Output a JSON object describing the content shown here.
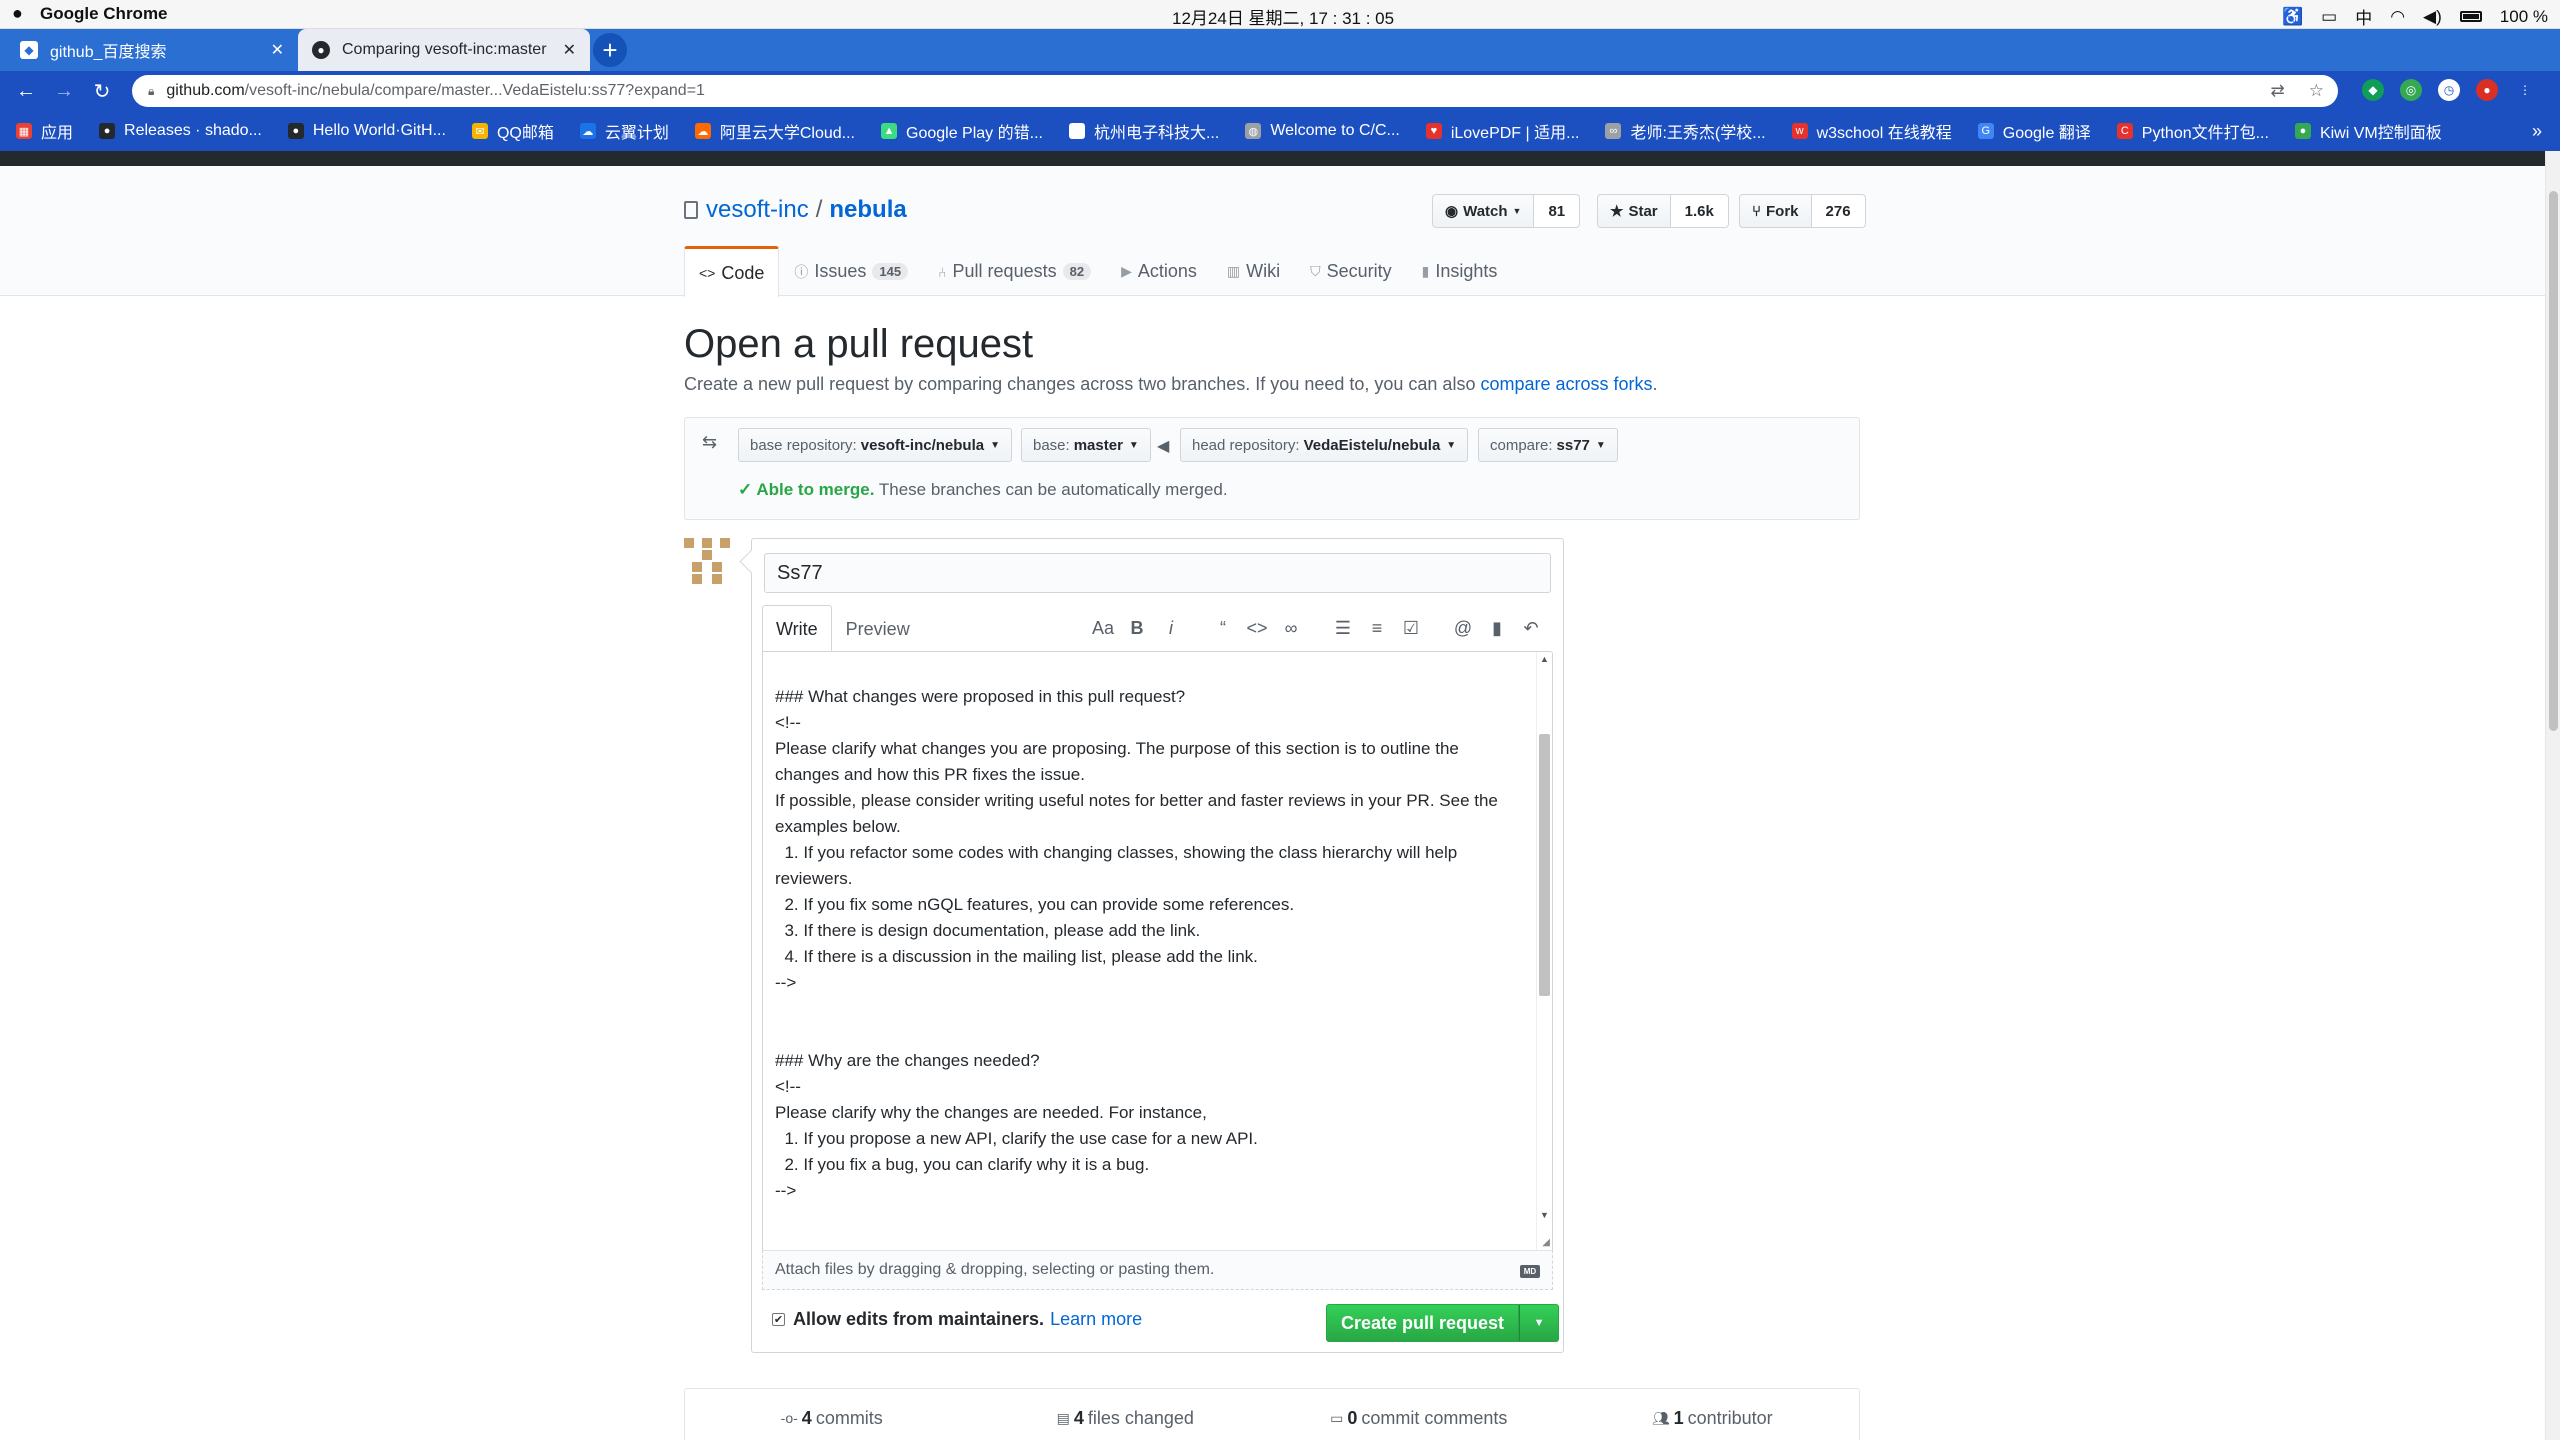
{
  "menubar": {
    "app_name": "Google Chrome",
    "clock": "12月24日 星期二, 17 : 31 : 05",
    "input_method": "中",
    "battery": "100 %"
  },
  "tabs": [
    {
      "title": "github_百度搜索",
      "close": "✕"
    },
    {
      "title": "Comparing vesoft-inc:master",
      "close": "✕"
    }
  ],
  "omnibox": {
    "host": "github.com",
    "path": "/vesoft-inc/nebula/compare/master...VedaEistelu:ss77?expand=1"
  },
  "bookmarks": [
    {
      "label": "应用",
      "icon": "apps-grid-icon",
      "color": "#e94235"
    },
    {
      "label": "Releases · shado...",
      "icon": "github-icon",
      "color": "#24292e"
    },
    {
      "label": "Hello World·GitH...",
      "icon": "github-icon",
      "color": "#24292e"
    },
    {
      "label": "QQ邮箱",
      "icon": "mail-icon",
      "color": "#f4b400"
    },
    {
      "label": "云翼计划",
      "icon": "cloud-icon",
      "color": "#1a73e8"
    },
    {
      "label": "阿里云大学Cloud...",
      "icon": "cloud-icon",
      "color": "#ff6a00"
    },
    {
      "label": "Google Play 的错...",
      "icon": "android-icon",
      "color": "#3ddc84"
    },
    {
      "label": "杭州电子科技大...",
      "icon": "page-icon",
      "color": "#ffffff"
    },
    {
      "label": "Welcome to C/C...",
      "icon": "globe-icon",
      "color": "#9aa0a6"
    },
    {
      "label": "iLovePDF | 适用...",
      "icon": "heart-icon",
      "color": "#e5322d"
    },
    {
      "label": "老师:王秀杰(学校...",
      "icon": "link-icon",
      "color": "#9aa0a6"
    },
    {
      "label": "w3school 在线教程",
      "icon": "w3-icon",
      "color": "#e5322d"
    },
    {
      "label": "Google 翻译",
      "icon": "translate-icon",
      "color": "#4285f4"
    },
    {
      "label": "Python文件打包...",
      "icon": "c-icon",
      "color": "#e5322d"
    },
    {
      "label": "Kiwi VM控制面板",
      "icon": "kiwi-icon",
      "color": "#34a853"
    }
  ],
  "repo": {
    "owner": "vesoft-inc",
    "separator": "/",
    "name": "nebula",
    "watch_label": "Watch",
    "watch_count": "81",
    "star_label": "Star",
    "star_count": "1.6k",
    "fork_label": "Fork",
    "fork_count": "276"
  },
  "reponav": [
    {
      "label": "Code",
      "icon": "code-icon",
      "count": ""
    },
    {
      "label": "Issues",
      "icon": "issue-icon",
      "count": "145"
    },
    {
      "label": "Pull requests",
      "icon": "pr-icon",
      "count": "82"
    },
    {
      "label": "Actions",
      "icon": "play-icon",
      "count": ""
    },
    {
      "label": "Wiki",
      "icon": "book-icon",
      "count": ""
    },
    {
      "label": "Security",
      "icon": "shield-icon",
      "count": ""
    },
    {
      "label": "Insights",
      "icon": "graph-icon",
      "count": ""
    }
  ],
  "subhead": {
    "title": "Open a pull request",
    "description": "Create a new pull request by comparing changes across two branches. If you need to, you can also ",
    "link": "compare across forks",
    "period": "."
  },
  "range": {
    "base_repo_label": "base repository:",
    "base_repo_value": "vesoft-inc/nebula",
    "base_label": "base:",
    "base_value": "master",
    "head_repo_label": "head repository:",
    "head_repo_value": "VedaEistelu/nebula",
    "compare_label": "compare:",
    "compare_value": "ss77",
    "merge_ok": "Able to merge.",
    "merge_text": " These branches can be automatically merged."
  },
  "composer": {
    "title_value": "Ss77",
    "tab_write": "Write",
    "tab_preview": "Preview",
    "body": "### What changes were proposed in this pull request?\n<!--\nPlease clarify what changes you are proposing. The purpose of this section is to outline the changes and how this PR fixes the issue.\nIf possible, please consider writing useful notes for better and faster reviews in your PR. See the examples below.\n  1. If you refactor some codes with changing classes, showing the class hierarchy will help reviewers.\n  2. If you fix some nGQL features, you can provide some references.\n  3. If there is design documentation, please add the link.\n  4. If there is a discussion in the mailing list, please add the link.\n-->\n\n\n### Why are the changes needed?\n<!--\nPlease clarify why the changes are needed. For instance,\n  1. If you propose a new API, clarify the use case for a new API.\n  2. If you fix a bug, you can clarify why it is a bug.\n-->",
    "attach_text": "Attach files by dragging & dropping, selecting or pasting them.",
    "md_badge": "MD",
    "allow_edits_label": "Allow edits from maintainers.",
    "learn_more": "Learn more",
    "create_button": "Create pull request"
  },
  "overall": {
    "commits_count": "4",
    "commits_label": "commits",
    "files_count": "4",
    "files_label": "files changed",
    "comments_count": "0",
    "comments_label": "commit comments",
    "contributors_count": "1",
    "contributors_label": "contributor"
  }
}
